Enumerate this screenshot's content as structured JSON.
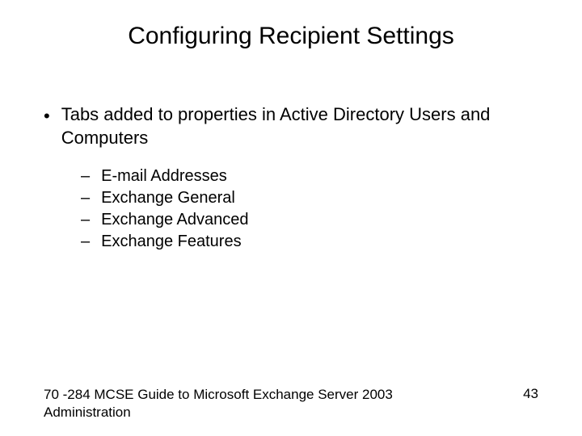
{
  "title": "Configuring Recipient Settings",
  "bullet": {
    "text": "Tabs added to properties in Active Directory Users and Computers",
    "subitems": [
      "E-mail Addresses",
      "Exchange General",
      "Exchange Advanced",
      "Exchange Features"
    ]
  },
  "footer": {
    "left": "70 -284 MCSE Guide to Microsoft Exchange Server 2003 Administration",
    "right": "43"
  }
}
